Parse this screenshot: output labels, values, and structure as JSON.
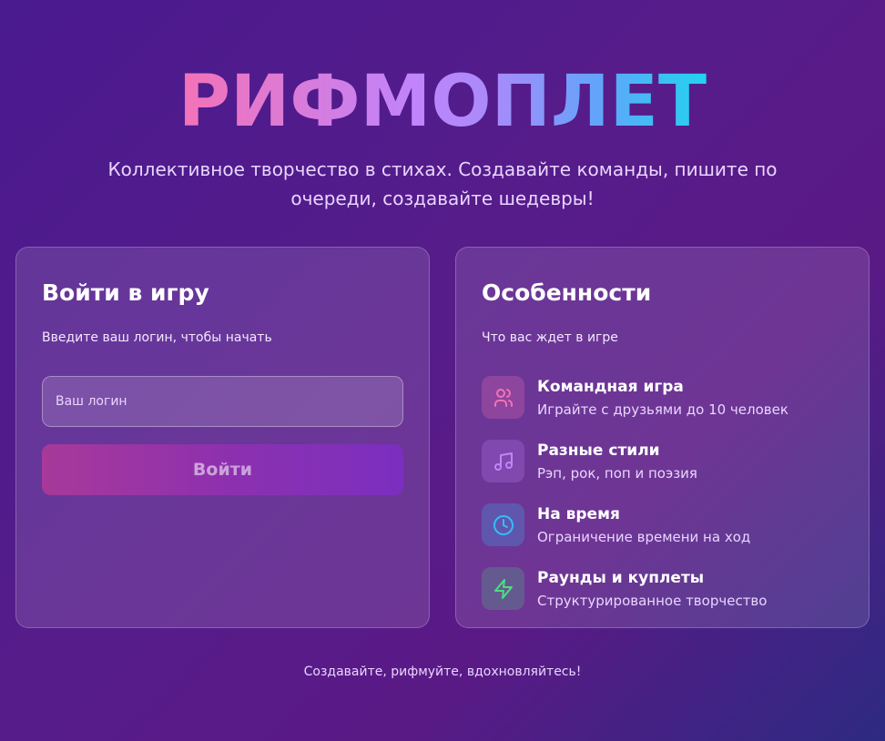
{
  "app": {
    "title": "РИФМОПЛЕТ",
    "subtitle": "Коллективное творчество в стихах. Создавайте команды, пишите по очереди, создавайте шедевры!"
  },
  "login": {
    "title": "Войти в игру",
    "subtitle": "Введите ваш логин, чтобы начать",
    "input_placeholder": "Ваш логин",
    "input_value": "",
    "button_label": "Войти"
  },
  "features": {
    "title": "Особенности",
    "subtitle": "Что вас ждет в игре",
    "items": [
      {
        "icon": "users-icon",
        "title": "Командная игра",
        "description": "Играйте с друзьями до 10 человек",
        "color": "#f472b6"
      },
      {
        "icon": "music-icon",
        "title": "Разные стили",
        "description": "Рэп, рок, поп и поэзия",
        "color": "#c084fc"
      },
      {
        "icon": "clock-icon",
        "title": "На время",
        "description": "Ограничение времени на ход",
        "color": "#38bdf8"
      },
      {
        "icon": "lightning-icon",
        "title": "Раунды и куплеты",
        "description": "Структурированное творчество",
        "color": "#4ade80"
      }
    ]
  },
  "footer": {
    "text": "Создавайте, рифмуйте, вдохновляйтесь!"
  },
  "colors": {
    "accent_pink": "#f472b6",
    "accent_purple": "#c084fc",
    "accent_blue": "#38bdf8",
    "accent_green": "#4ade80"
  }
}
